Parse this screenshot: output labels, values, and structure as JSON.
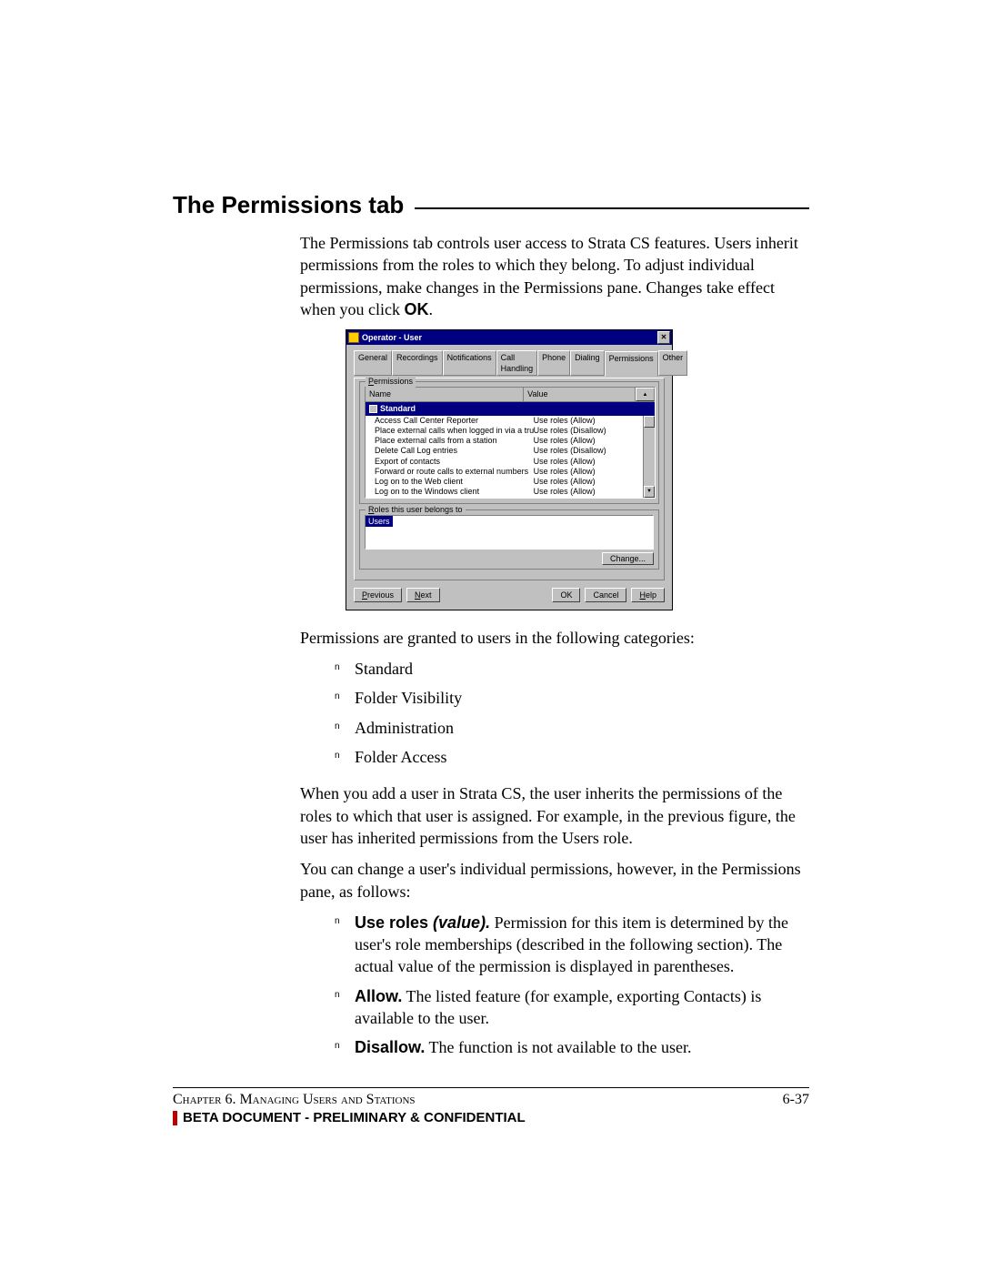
{
  "heading": "The Permissions tab",
  "intro_parts": {
    "p1": "The Permissions tab controls user access to Strata CS features. Users inherit permissions from the roles to which they belong. To adjust individual permissions, make changes in the Permissions pane. Changes take effect when you click ",
    "ok_strong": "OK",
    "p1_end": "."
  },
  "dialog": {
    "title": "Operator - User",
    "tabs": [
      "General",
      "Recordings",
      "Notifications",
      "Call Handling",
      "Phone",
      "Dialing",
      "Permissions",
      "Other"
    ],
    "active_tab": "Permissions",
    "group_permissions": "Permissions",
    "col_name": "Name",
    "col_value": "Value",
    "category": "Standard",
    "rows": [
      {
        "name": "Access Call Center Reporter",
        "value": "Use roles (Allow)"
      },
      {
        "name": "Place external calls when logged in via a trunk",
        "value": "Use roles (Disallow)"
      },
      {
        "name": "Place external calls from a station",
        "value": "Use roles (Allow)"
      },
      {
        "name": "Delete Call Log entries",
        "value": "Use roles (Disallow)"
      },
      {
        "name": "Export of contacts",
        "value": "Use roles (Allow)"
      },
      {
        "name": "Forward or route calls to external numbers",
        "value": "Use roles (Allow)"
      },
      {
        "name": "Log on to the Web client",
        "value": "Use roles (Allow)"
      },
      {
        "name": "Log on to the Windows client",
        "value": "Use roles (Allow)"
      }
    ],
    "group_roles": "Roles this user belongs to",
    "role_item": "Users",
    "buttons": {
      "change": "Change...",
      "previous": "Previous",
      "next": "Next",
      "ok": "OK",
      "cancel": "Cancel",
      "help": "Help"
    }
  },
  "after1": "Permissions are granted to users in the following categories:",
  "categories": [
    "Standard",
    "Folder Visibility",
    "Administration",
    "Folder Access"
  ],
  "after2": "When you add a user in Strata CS, the user inherits the permissions of the roles to which that user is assigned. For example, in the previous figure, the user has inherited permissions from the Users role.",
  "after3": "You can change a user's individual permissions, however, in the Permissions pane, as follows:",
  "options": [
    {
      "bold": "Use roles ",
      "ital": "(value).",
      "rest": " Permission for this item is determined by the user's role memberships (described in the following section). The actual value of the permission is displayed in parentheses."
    },
    {
      "bold": "Allow.",
      "ital": "",
      "rest": " The listed feature (for example, exporting Contacts) is available to the user."
    },
    {
      "bold": "Disallow.",
      "ital": "",
      "rest": " The function is not available to the user."
    }
  ],
  "footer": {
    "chapter": "Chapter 6. Managing Users and Stations",
    "page": "6-37",
    "beta": "BETA DOCUMENT - PRELIMINARY & CONFIDENTIAL"
  }
}
